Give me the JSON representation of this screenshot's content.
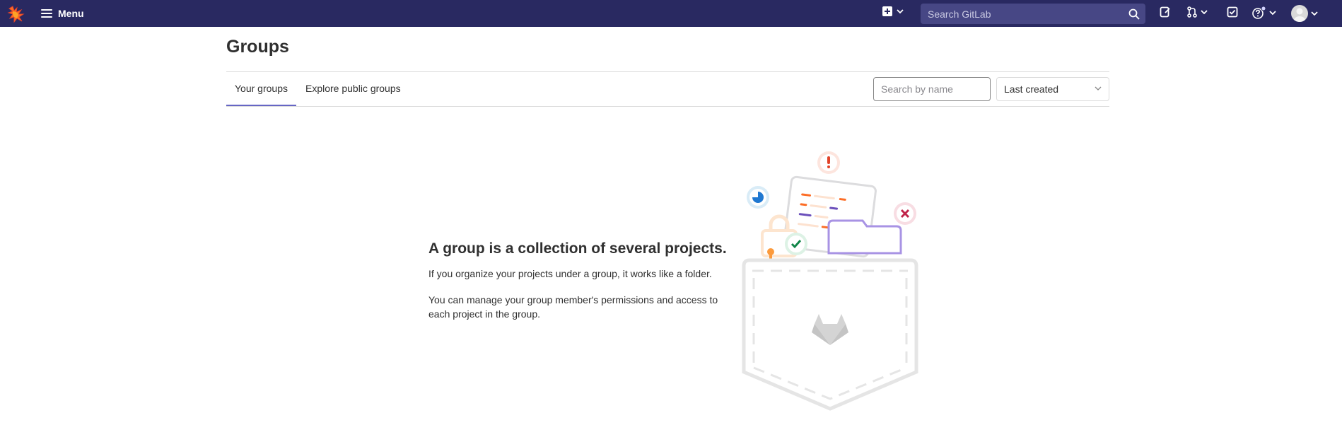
{
  "navbar": {
    "menu_label": "Menu",
    "search_placeholder": "Search GitLab",
    "colors": {
      "background": "#292961",
      "search_bg": "#474785"
    },
    "icons": [
      "gitlab-fox-logo",
      "hamburger-icon",
      "plus-square-icon",
      "chevron-down-icon",
      "search-icon",
      "issues-icon",
      "merge-request-icon",
      "todo-icon",
      "help-icon",
      "avatar"
    ]
  },
  "page": {
    "title": "Groups",
    "tabs": [
      {
        "label": "Your groups",
        "active": true
      },
      {
        "label": "Explore public groups",
        "active": false
      }
    ],
    "filter_placeholder": "Search by name",
    "sort_selected": "Last created",
    "accent_color": "#6666c4"
  },
  "empty_state": {
    "heading": "A group is a collection of several projects.",
    "paragraphs": [
      "If you organize your projects under a group, it works like a folder.",
      "You can manage your group member's permissions and access to each project in the group."
    ],
    "illustration": "groups-pocket-illustration"
  }
}
